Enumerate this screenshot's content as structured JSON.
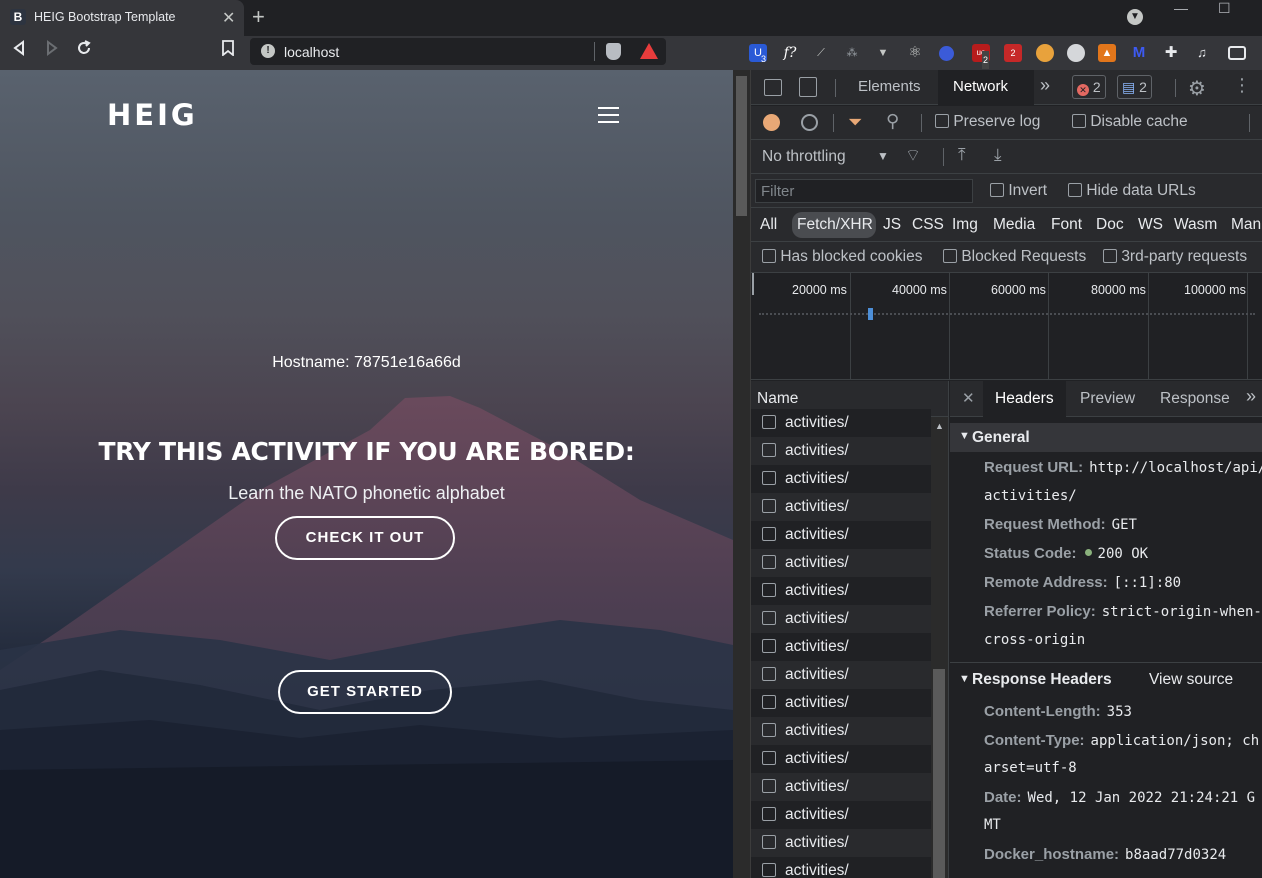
{
  "browser": {
    "tab_title": "HEIG Bootstrap Template",
    "tab_favicon": "B",
    "url": "localhost",
    "extension_badges": [
      "3",
      "2"
    ]
  },
  "page": {
    "logo": "HEIG",
    "hostname": "Hostname: 78751e16a66d",
    "headline": "TRY THIS ACTIVITY IF YOU ARE BORED:",
    "activity": "Learn the NATO phonetic alphabet",
    "check_button": "CHECK IT OUT",
    "start_button": "GET STARTED"
  },
  "devtools": {
    "tabs": [
      "Elements",
      "Network"
    ],
    "active_tab": "Network",
    "error_count": "2",
    "message_count": "2",
    "preserve_log": "Preserve log",
    "disable_cache": "Disable cache",
    "throttling": "No throttling",
    "filter_placeholder": "Filter",
    "invert": "Invert",
    "hide_data_urls": "Hide data URLs",
    "types": [
      "All",
      "Fetch/XHR",
      "JS",
      "CSS",
      "Img",
      "Media",
      "Font",
      "Doc",
      "WS",
      "Wasm",
      "Man"
    ],
    "active_type": "Fetch/XHR",
    "has_blocked_cookies": "Has blocked cookies",
    "blocked_requests": "Blocked Requests",
    "third_party": "3rd-party requests",
    "timeline_ticks": [
      "20000 ms",
      "40000 ms",
      "60000 ms",
      "80000 ms",
      "100000 ms"
    ],
    "name_header": "Name",
    "request_name": "activities/",
    "detail_tabs": [
      "Headers",
      "Preview",
      "Response"
    ],
    "active_detail_tab": "Headers",
    "general": {
      "title": "General",
      "request_url_key": "Request URL:",
      "request_url_val": "http://localhost/api/",
      "request_url_cont": "activities/",
      "method_key": "Request Method:",
      "method_val": "GET",
      "status_key": "Status Code:",
      "status_val": "200 OK",
      "remote_key": "Remote Address:",
      "remote_val": "[::1]:80",
      "referrer_key": "Referrer Policy:",
      "referrer_val": "strict-origin-when-",
      "referrer_cont": "cross-origin"
    },
    "response_headers": {
      "title": "Response Headers",
      "view_source": "View source",
      "length_key": "Content-Length:",
      "length_val": "353",
      "type_key": "Content-Type:",
      "type_val": "application/json; ch",
      "type_cont": "arset=utf-8",
      "date_key": "Date:",
      "date_val": "Wed, 12 Jan 2022 21:24:21 G",
      "date_cont": "MT",
      "docker_key": "Docker_hostname:",
      "docker_val": "b8aad77d0324"
    }
  }
}
